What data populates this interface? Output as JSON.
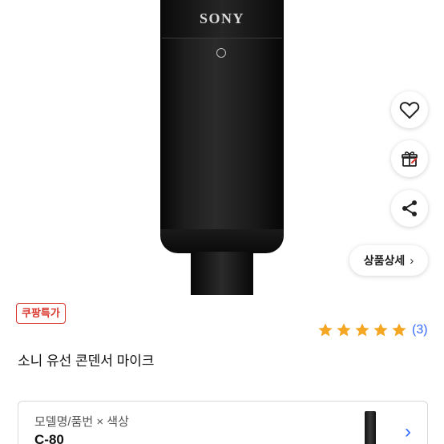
{
  "product_image": {
    "brand": "SONY"
  },
  "actions": {
    "wishlist_icon": "heart-icon",
    "gift_icon": "gift-icon",
    "share_icon": "share-icon",
    "detail_label": "상품상세",
    "detail_chevron": "›"
  },
  "badge": {
    "label": "쿠팡특가"
  },
  "rating": {
    "stars": 5,
    "max": 5,
    "count": "(3)",
    "color": "#f5a623"
  },
  "product": {
    "title": "소니 유선 콘덴서 마이크"
  },
  "option": {
    "label": "모델명/품번 × 색상",
    "value": "C-80",
    "chevron": "›"
  },
  "colors": {
    "accent": "#346aff",
    "badge": "#d8342c"
  }
}
